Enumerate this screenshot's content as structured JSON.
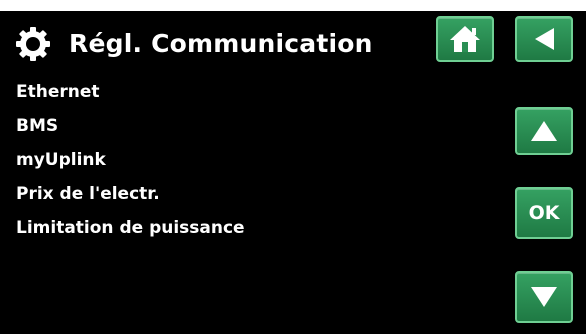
{
  "header": {
    "title": "Régl. Communication",
    "settings_icon": "gear-icon",
    "home_icon": "home-icon",
    "back_icon": "back-arrow-icon"
  },
  "menu": {
    "items": [
      {
        "label": "Ethernet"
      },
      {
        "label": "BMS"
      },
      {
        "label": "myUplink"
      },
      {
        "label": "Prix de l'electr."
      },
      {
        "label": "Limitation de puissance"
      }
    ]
  },
  "nav": {
    "up_icon": "arrow-up-icon",
    "ok_label": "OK",
    "down_icon": "arrow-down-icon"
  },
  "colors": {
    "background": "#000000",
    "text": "#ffffff",
    "button": "#2a8f54",
    "button_border": "#6fcf93"
  }
}
